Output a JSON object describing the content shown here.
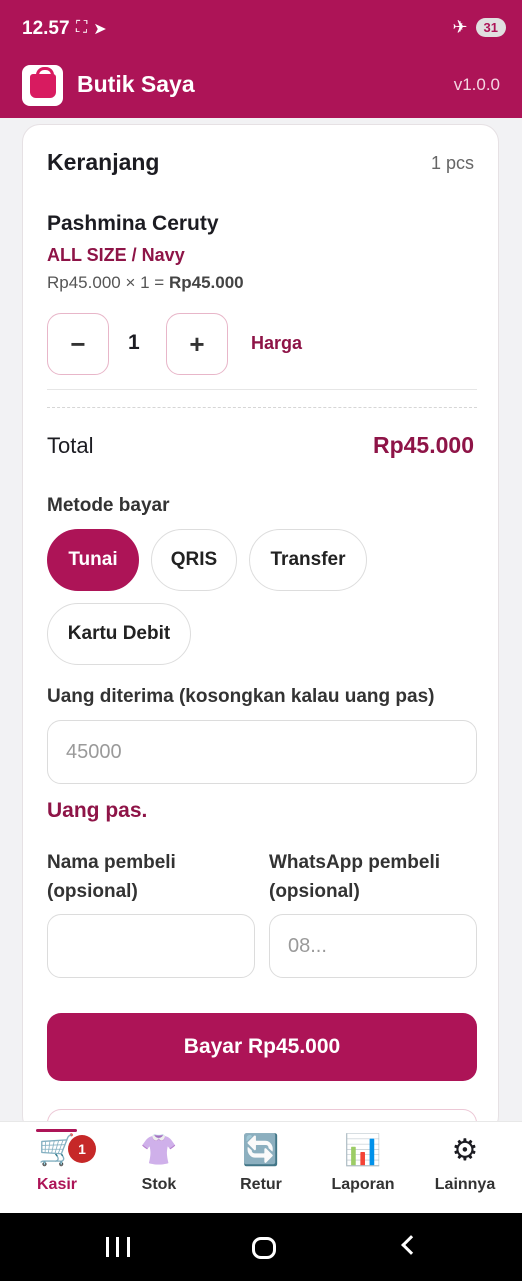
{
  "status_bar": {
    "time": "12.57",
    "battery": "31"
  },
  "app": {
    "title": "Butik Saya",
    "version": "v1.0.0"
  },
  "cart": {
    "title": "Keranjang",
    "count": "1 pcs",
    "item": {
      "name": "Pashmina Ceruty",
      "variant": "ALL SIZE / Navy",
      "calc_prefix": "Rp45.000 × 1 =",
      "calc_total": "Rp45.000",
      "minus": "−",
      "qty": "1",
      "plus": "+",
      "price_link": "Harga"
    },
    "total_label": "Total",
    "total_value": "Rp45.000"
  },
  "payment": {
    "label": "Metode bayar",
    "methods": [
      "Tunai",
      "QRIS",
      "Transfer",
      "Kartu Debit"
    ],
    "selected": "Tunai"
  },
  "cash": {
    "label": "Uang diterima (kosongkan kalau uang pas)",
    "placeholder": "45000",
    "note": "Uang pas."
  },
  "buyer": {
    "name_label": "Nama pembeli (opsional)",
    "name_placeholder": "",
    "wa_label": "WhatsApp pembeli (opsional)",
    "wa_placeholder": "08..."
  },
  "pay_button": "Bayar Rp45.000",
  "bottom_nav": {
    "items": [
      {
        "label": "Kasir",
        "icon": "cart-icon",
        "badge": "1",
        "active": true
      },
      {
        "label": "Stok",
        "icon": "shirt-icon"
      },
      {
        "label": "Retur",
        "icon": "refresh-icon"
      },
      {
        "label": "Laporan",
        "icon": "bar-chart-icon"
      },
      {
        "label": "Lainnya",
        "icon": "gear-icon"
      }
    ]
  },
  "colors": {
    "primary": "#ad1457",
    "accent_text": "#8e1447",
    "badge": "#c62828"
  }
}
